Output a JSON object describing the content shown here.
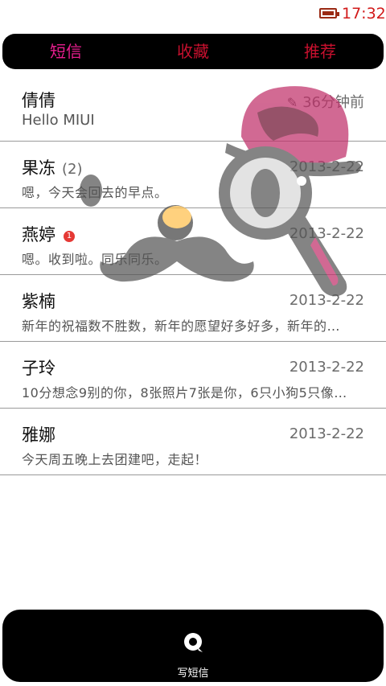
{
  "status_bar": {
    "time": "17:32",
    "battery_icon": "battery-icon"
  },
  "tabs": [
    {
      "label": "短信",
      "active": true
    },
    {
      "label": "收藏",
      "active": false
    },
    {
      "label": "推荐",
      "active": false
    }
  ],
  "conversations": [
    {
      "name": "倩倩",
      "time": "36分钟前",
      "time_icon": "pencil-icon",
      "preview": "Hello MIUI"
    },
    {
      "name": "果冻",
      "count": "(2)",
      "time": "2013-2-22",
      "preview": "嗯，今天会回去的早点。"
    },
    {
      "name": "燕婷",
      "badge": "1",
      "time": "2013-2-22",
      "preview": "嗯。收到啦。同乐同乐。"
    },
    {
      "name": "紫楠",
      "time": "2013-2-22",
      "preview": "新年的祝福数不胜数，新年的愿望好多好多，新年的…"
    },
    {
      "name": "子玲",
      "time": "2013-2-22",
      "preview": "10分想念9别的你，8张照片7张是你，6只小狗5只像…"
    },
    {
      "name": "雅娜",
      "time": "2013-2-22",
      "preview": "今天周五晚上去团建吧，走起！"
    }
  ],
  "bottom_bar": {
    "compose_label": "写短信",
    "compose_icon": "search-bubble-icon"
  },
  "colors": {
    "tab_active": "#e91e8f",
    "tab_inactive": "#c8102e",
    "clock": "#d21a1a",
    "badge": "#e53935"
  }
}
